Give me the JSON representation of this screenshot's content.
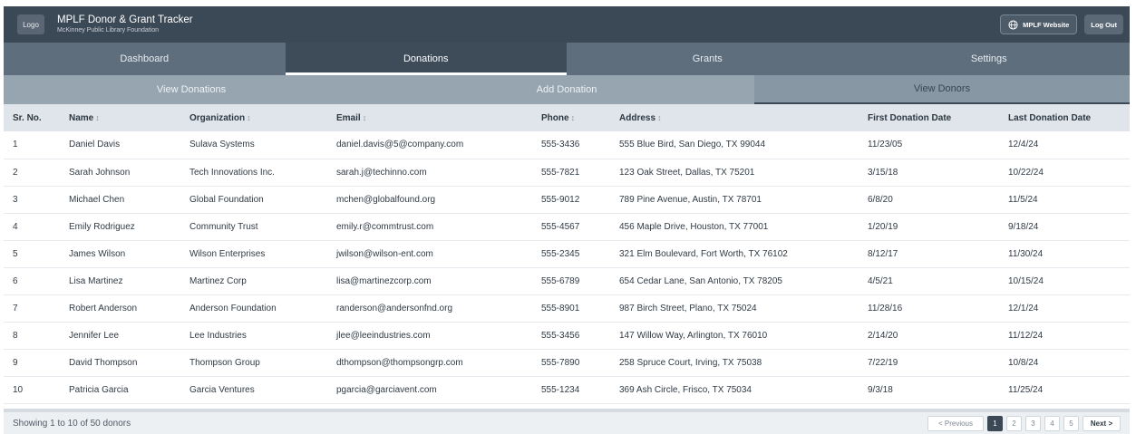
{
  "header": {
    "logo_text": "Logo",
    "title": "MPLF Donor & Grant Tracker",
    "subtitle": "McKinney Public Library Foundation",
    "website_label": "MPLF Website",
    "logout_label": "Log Out"
  },
  "nav": {
    "tabs": [
      {
        "label": "Dashboard"
      },
      {
        "label": "Donations"
      },
      {
        "label": "Grants"
      },
      {
        "label": "Settings"
      }
    ]
  },
  "subnav": {
    "tabs": [
      {
        "label": "View Donations"
      },
      {
        "label": "Add Donation"
      },
      {
        "label": "View Donors"
      }
    ]
  },
  "table": {
    "headers": {
      "sr": "Sr. No.",
      "name": "Name",
      "organization": "Organization",
      "email": "Email",
      "phone": "Phone",
      "address": "Address",
      "first": "First Donation Date",
      "last": "Last Donation Date"
    },
    "sort_glyph": "↕",
    "rows": [
      {
        "sr": "1",
        "name": "Daniel Davis",
        "organization": "Sulava Systems",
        "email": "daniel.davis@5@company.com",
        "phone": "555-3436",
        "address": "555 Blue Bird, San Diego, TX 99044",
        "first": "11/23/05",
        "last": "12/4/24"
      },
      {
        "sr": "2",
        "name": "Sarah Johnson",
        "organization": "Tech Innovations Inc.",
        "email": "sarah.j@techinno.com",
        "phone": "555-7821",
        "address": "123 Oak Street, Dallas, TX 75201",
        "first": "3/15/18",
        "last": "10/22/24"
      },
      {
        "sr": "3",
        "name": "Michael Chen",
        "organization": "Global Foundation",
        "email": "mchen@globalfound.org",
        "phone": "555-9012",
        "address": "789 Pine Avenue, Austin, TX 78701",
        "first": "6/8/20",
        "last": "11/5/24"
      },
      {
        "sr": "4",
        "name": "Emily Rodriguez",
        "organization": "Community Trust",
        "email": "emily.r@commtrust.com",
        "phone": "555-4567",
        "address": "456 Maple Drive, Houston, TX 77001",
        "first": "1/20/19",
        "last": "9/18/24"
      },
      {
        "sr": "5",
        "name": "James Wilson",
        "organization": "Wilson Enterprises",
        "email": "jwilson@wilson-ent.com",
        "phone": "555-2345",
        "address": "321 Elm Boulevard, Fort Worth, TX 76102",
        "first": "8/12/17",
        "last": "11/30/24"
      },
      {
        "sr": "6",
        "name": "Lisa Martinez",
        "organization": "Martinez Corp",
        "email": "lisa@martinezcorp.com",
        "phone": "555-6789",
        "address": "654 Cedar Lane, San Antonio, TX 78205",
        "first": "4/5/21",
        "last": "10/15/24"
      },
      {
        "sr": "7",
        "name": "Robert Anderson",
        "organization": "Anderson Foundation",
        "email": "randerson@andersonfnd.org",
        "phone": "555-8901",
        "address": "987 Birch Street, Plano, TX 75024",
        "first": "11/28/16",
        "last": "12/1/24"
      },
      {
        "sr": "8",
        "name": "Jennifer Lee",
        "organization": "Lee Industries",
        "email": "jlee@leeindustries.com",
        "phone": "555-3456",
        "address": "147 Willow Way, Arlington, TX 76010",
        "first": "2/14/20",
        "last": "11/12/24"
      },
      {
        "sr": "9",
        "name": "David Thompson",
        "organization": "Thompson Group",
        "email": "dthompson@thompsongrp.com",
        "phone": "555-7890",
        "address": "258 Spruce Court, Irving, TX 75038",
        "first": "7/22/19",
        "last": "10/8/24"
      },
      {
        "sr": "10",
        "name": "Patricia Garcia",
        "organization": "Garcia Ventures",
        "email": "pgarcia@garciavent.com",
        "phone": "555-1234",
        "address": "369 Ash Circle, Frisco, TX 75034",
        "first": "9/3/18",
        "last": "11/25/24"
      }
    ]
  },
  "footer": {
    "showing": "Showing 1 to 10 of 50 donors",
    "prev_label": "< Previous",
    "pages": [
      "1",
      "2",
      "3",
      "4",
      "5"
    ],
    "next_label": "Next >"
  },
  "colors": {
    "header_bg": "#3b4856",
    "nav_bg": "#5f6e7c",
    "subnav_bg": "#97a5b0",
    "table_header_bg": "#dfe5ea"
  }
}
